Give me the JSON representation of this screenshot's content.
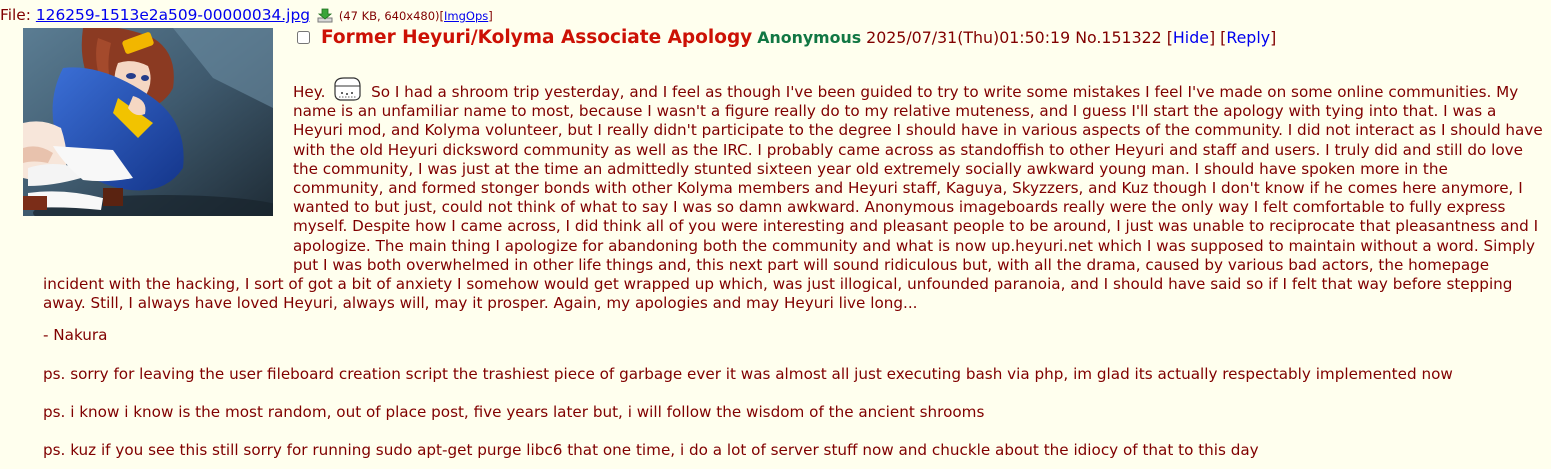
{
  "file": {
    "prefix": "File:",
    "name": "126259-1513e2a509-00000034.jpg",
    "info": "(47 KB, 640x480)",
    "imgops_open": "[",
    "imgops": "ImgOps",
    "imgops_close": "]"
  },
  "post": {
    "subject": "Former Heyuri/Kolyma Associate Apology",
    "name": "Anonymous",
    "datetime": "2025/07/31(Thu)01:50:19",
    "number": "No.151322",
    "hide_label": "Hide",
    "reply_label": "Reply",
    "body_lead": "Hey.",
    "body_main": "So I had a shroom trip yesterday, and I feel as though I've been guided to try to write some mistakes I feel I've made on some online communities. My name is an unfamiliar name to most, because I wasn't a figure really do to my relative muteness, and I guess I'll start the apology with tying into that. I was a Heyuri mod, and Kolyma volunteer, but I really didn't participate to the degree I should have in various aspects of the community. I did not interact as I should have with the old Heyuri dicksword community as well as the IRC. I probably came across as standoffish to other Heyuri and staff and users. I truly did and still do love the community, I was just at the time an admittedly stunted sixteen year old extremely socially awkward young man. I should have spoken more in the community, and formed stonger bonds with other Kolyma members and Heyuri staff, Kaguya, Skyzzers, and Kuz though I don't know if he comes here anymore, I wanted to but just, could not think of what to say I was so damn awkward. Anonymous imageboards really were the only way I felt comfortable to fully express myself. Despite how I came across, I did think all of you were interesting and pleasant people to be around, I just was unable to reciprocate that pleasantness and I apologize. The main thing I apologize for abandoning both the community and what is now up.heyuri.net which I was supposed to maintain without a word. Simply put I was both overwhelmed in other life things and, this next part will sound ridiculous but, with all the drama, caused by various bad actors, the homepage incident with the hacking, I sort of got a bit of anxiety I somehow would get wrapped up which, was just illogical, unfounded paranoia, and I should have said so if I felt that way before stepping away. Still, I always have loved Heyuri, always will, may it prosper. Again, my apologies and may Heyuri live long...",
    "signature": "- Nakura",
    "ps1": "ps. sorry for leaving the user fileboard creation script the trashiest piece of garbage ever it was almost all just executing bash via php, im glad its actually respectably implemented now",
    "ps2": "ps. i know i know is the most random, out of place post, five years later but, i will follow the wisdom of the ancient shrooms",
    "ps3": "ps. kuz if you see this still sorry for running sudo apt-get purge libc6 that one time, i do a lot of server stuff now and chuckle about the idiocy of that to this day"
  },
  "colors": {
    "background": "#ffffee",
    "text": "#800000",
    "subject": "#cc1105",
    "name": "#117743",
    "link": "#0000ee"
  },
  "icons": [
    "download-icon",
    "kaomoji-emote-icon"
  ]
}
